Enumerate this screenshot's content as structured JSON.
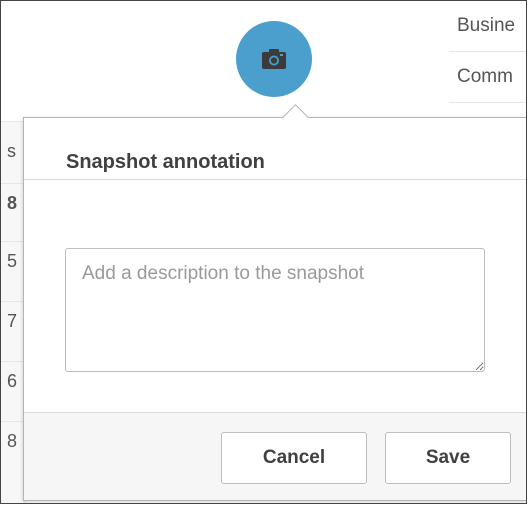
{
  "background": {
    "right_list": [
      "Busine",
      "Comm"
    ],
    "left_glyphs": [
      "s",
      "8",
      "5",
      "7",
      "6",
      "8"
    ]
  },
  "camera_button": {
    "icon": "camera-icon",
    "color": "#4a9fcc"
  },
  "dialog": {
    "title": "Snapshot annotation",
    "description_field": {
      "value": "",
      "placeholder": "Add a description to the snapshot"
    },
    "cancel_label": "Cancel",
    "save_label": "Save"
  }
}
